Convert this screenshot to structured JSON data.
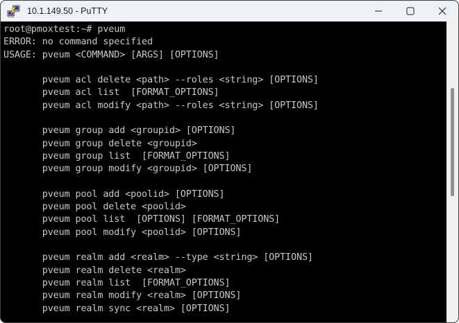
{
  "window": {
    "title": "10.1.149.50 - PuTTY",
    "icon": "putty-icon",
    "controls": [
      {
        "name": "minimize",
        "icon": "minimize-icon"
      },
      {
        "name": "maximize",
        "icon": "maximize-icon"
      },
      {
        "name": "close",
        "icon": "close-icon"
      }
    ]
  },
  "colors": {
    "titlebar_background": "#eef2f4",
    "titlebar_text": "#1b1b1b",
    "terminal_background": "#000000",
    "terminal_foreground": "#c8c8c8",
    "scrollbar_track": "#f0f0f0",
    "scrollbar_thumb": "#8f8f8f",
    "putty_icon_screen": "#2233bb",
    "putty_icon_bolt": "#ffd700"
  },
  "terminal": {
    "lines": [
      "root@pmoxtest:~# pveum",
      "ERROR: no command specified",
      "USAGE: pveum <COMMAND> [ARGS] [OPTIONS]",
      "",
      "       pveum acl delete <path> --roles <string> [OPTIONS]",
      "       pveum acl list  [FORMAT_OPTIONS]",
      "       pveum acl modify <path> --roles <string> [OPTIONS]",
      "",
      "       pveum group add <groupid> [OPTIONS]",
      "       pveum group delete <groupid>",
      "       pveum group list  [FORMAT_OPTIONS]",
      "       pveum group modify <groupid> [OPTIONS]",
      "",
      "       pveum pool add <poolid> [OPTIONS]",
      "       pveum pool delete <poolid>",
      "       pveum pool list  [OPTIONS] [FORMAT_OPTIONS]",
      "       pveum pool modify <poolid> [OPTIONS]",
      "",
      "       pveum realm add <realm> --type <string> [OPTIONS]",
      "       pveum realm delete <realm>",
      "       pveum realm list  [FORMAT_OPTIONS]",
      "       pveum realm modify <realm> [OPTIONS]",
      "       pveum realm sync <realm> [OPTIONS]"
    ]
  }
}
